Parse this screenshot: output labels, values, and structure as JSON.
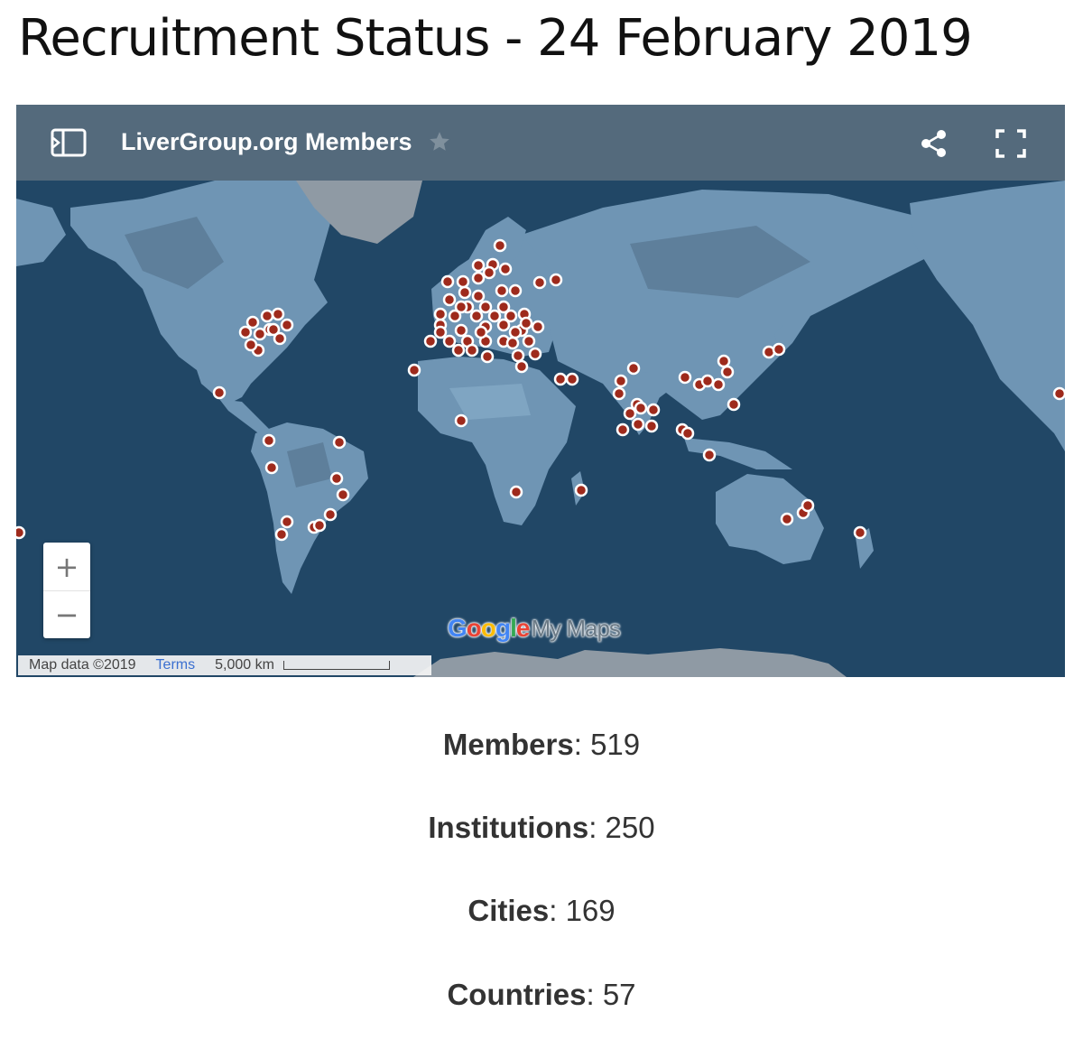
{
  "page": {
    "title": "Recruitment Status - 24 February 2019"
  },
  "map": {
    "name": "LiverGroup.org Members",
    "icons": {
      "legend_toggle": "legend-panel-icon",
      "favorite": "star-icon",
      "share": "share-icon",
      "fullscreen": "fullscreen-icon"
    },
    "zoom_in_label": "+",
    "zoom_out_label": "−",
    "attribution": "Map data ©2019",
    "terms_label": "Terms",
    "scale_label": "5,000 km",
    "logo": {
      "google": "Google",
      "product": "My Maps"
    },
    "colors": {
      "ocean": "#214766",
      "land": "#6f95b4",
      "terrain": "#5e7f9b",
      "ice": "#8f9aa4",
      "header": "#546a7c",
      "marker_fill": "#9e2a1c",
      "marker_ring": "#ffffff"
    }
  },
  "stats": [
    {
      "label": "Members",
      "separator": ":",
      "value": "519"
    },
    {
      "label": "Institutions",
      "separator": ":",
      "value": "250"
    },
    {
      "label": "Cities",
      "separator": ":",
      "value": "169"
    },
    {
      "label": "Countries",
      "separator": ":",
      "value": "57"
    }
  ]
}
